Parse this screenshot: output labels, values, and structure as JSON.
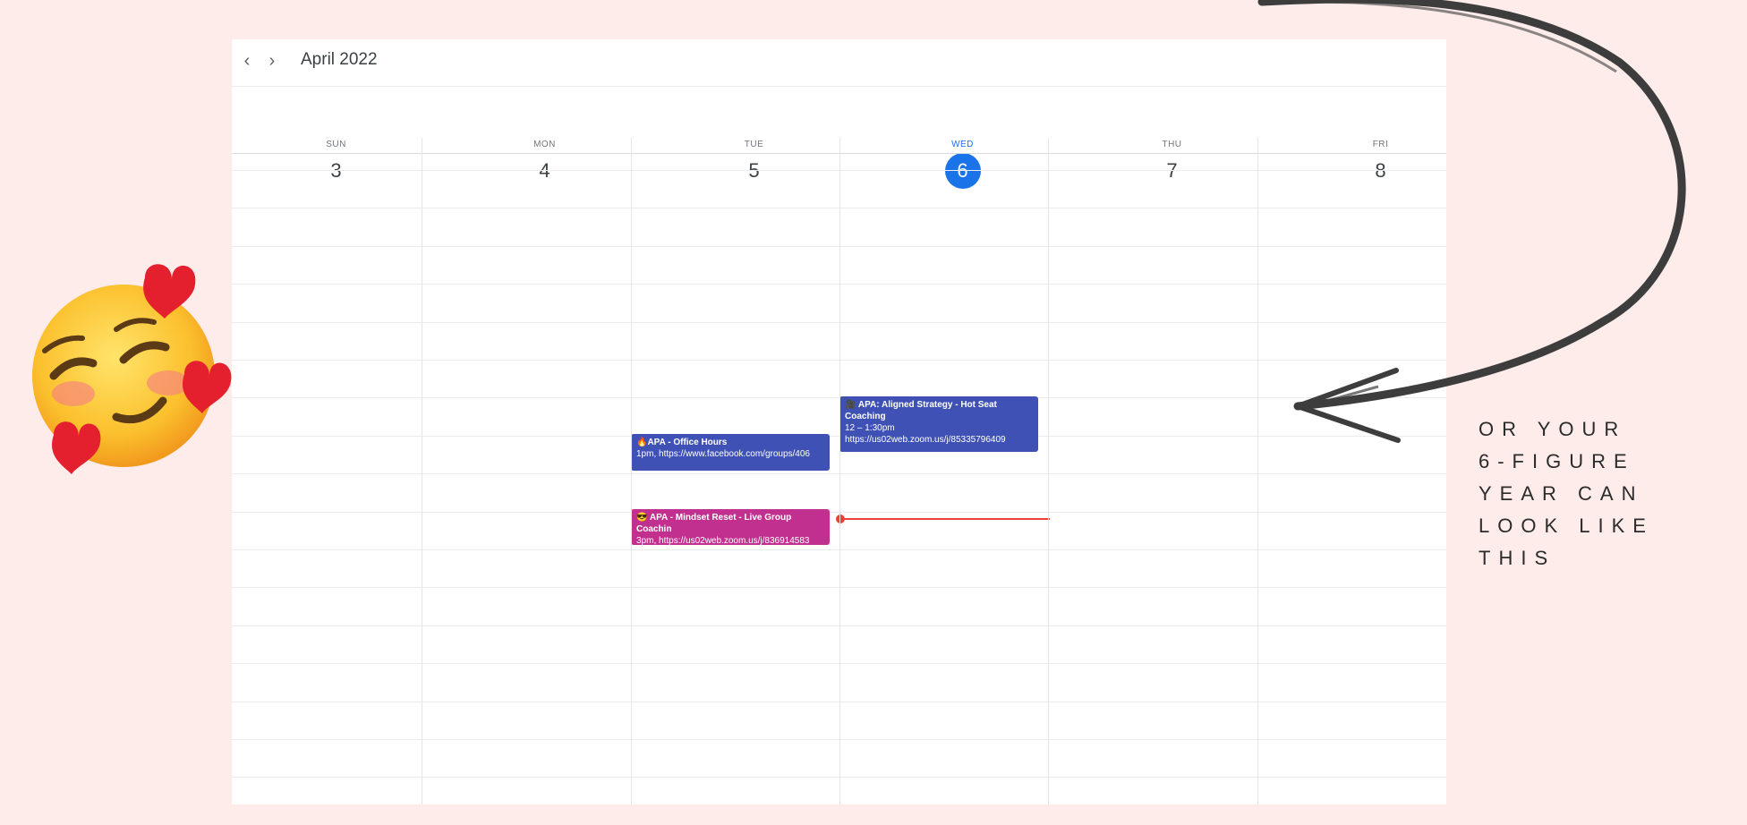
{
  "calendar": {
    "month_title": "April 2022",
    "prev_label": "‹",
    "next_label": "›",
    "days": [
      {
        "dow": "SUN",
        "num": "3"
      },
      {
        "dow": "MON",
        "num": "4"
      },
      {
        "dow": "TUE",
        "num": "5"
      },
      {
        "dow": "WED",
        "num": "6",
        "today": true
      },
      {
        "dow": "THU",
        "num": "7"
      },
      {
        "dow": "FRI",
        "num": "8"
      }
    ],
    "events": {
      "office_hours": {
        "icon": "🔥",
        "title": "APA - Office Hours",
        "detail": "1pm, https://www.facebook.com/groups/406"
      },
      "aligned_strategy": {
        "icon": "🎥",
        "title": "APA: Aligned Strategy - Hot Seat Coaching",
        "time": "12 – 1:30pm",
        "detail": "https://us02web.zoom.us/j/85335796409"
      },
      "mindset_reset": {
        "icon": "😎",
        "title": "APA - Mindset Reset - Live Group Coachin",
        "detail": "3pm, https://us02web.zoom.us/j/836914583"
      }
    },
    "colors": {
      "today": "#1a73e8",
      "event_blue": "#3f51b5",
      "event_pink": "#c2308f",
      "now_indicator": "#ea4335"
    }
  },
  "tagline": {
    "line1": "OR YOUR",
    "line2": "6-FIGURE",
    "line3": "YEAR CAN",
    "line4": "LOOK LIKE",
    "line5": "THIS"
  },
  "decor": {
    "emoji_icon": "smiling-face-with-hearts-icon",
    "arrow_icon": "curved-arrow-icon"
  }
}
